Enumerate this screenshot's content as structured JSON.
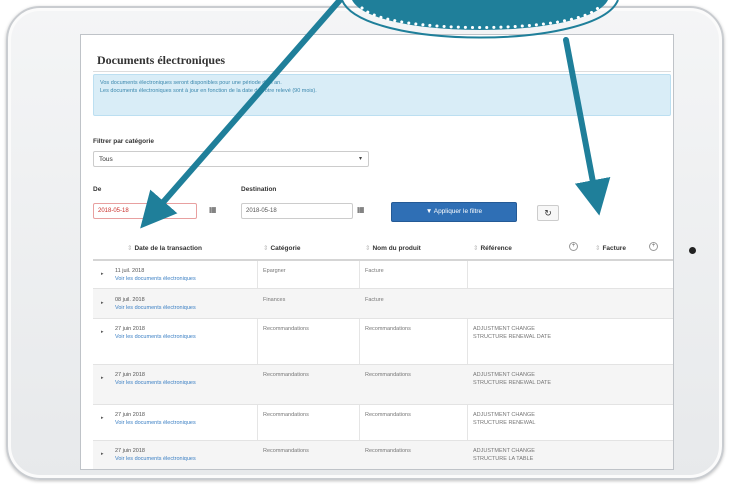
{
  "page": {
    "title": "Documents électroniques",
    "info_lines": [
      "Vos documents électroniques seront disponibles pour une période d'un an.",
      "Les documents électroniques sont à jour en fonction de la date de votre relevé (90 mois)."
    ]
  },
  "filter": {
    "category_label": "Filtrer par catégorie",
    "category_value": "Tous",
    "from_label": "De",
    "from_value": "2018-05-18",
    "to_label": "Destination",
    "to_value": "2018-05-18",
    "apply_label": "Appliquer le filtre",
    "reset_symbol": "↻"
  },
  "table": {
    "columns": [
      "Date de la transaction",
      "Catégorie",
      "Nom du produit",
      "Référence",
      "Facture"
    ],
    "sort_symbol": "⇕",
    "rows": [
      {
        "date": "11 juil. 2018",
        "link": "Voir les documents électroniques",
        "category": "Epargner",
        "product": "Facture",
        "reference": ""
      },
      {
        "date": "08 juil. 2018",
        "link": "Voir les documents électroniques",
        "category": "Finances",
        "product": "Facture",
        "reference": ""
      },
      {
        "date": "27 juin 2018",
        "link": "Voir les documents électroniques",
        "category": "Recommandations",
        "product": "Recommandations",
        "reference": "ADJUSTMENT CHANGE STRUCTURE RENEWAL DATE"
      },
      {
        "date": "27 juin 2018",
        "link": "Voir les documents électroniques",
        "category": "Recommandations",
        "product": "Recommandations",
        "reference": "ADJUSTMENT CHANGE STRUCTURE RENEWAL DATE"
      },
      {
        "date": "27 juin 2018",
        "link": "Voir les documents électroniques",
        "category": "Recommandations",
        "product": "Recommandations",
        "reference": "ADJUSTMENT CHANGE STRUCTURE RENEWAL"
      },
      {
        "date": "27 juin 2018",
        "link": "Voir les documents électroniques",
        "category": "Recommandations",
        "product": "Recommandations",
        "reference": "ADJUSTMENT CHANGE STRUCTURE LA TABLE"
      }
    ]
  },
  "colors": {
    "accent": "#1f7f9a",
    "info_bg": "#d9edf7",
    "button": "#2f6fb5"
  }
}
